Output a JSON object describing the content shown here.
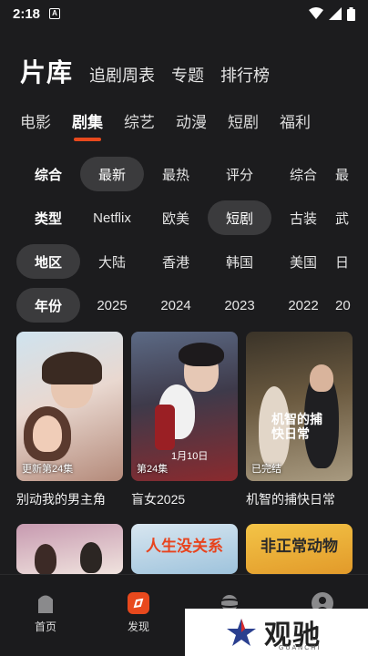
{
  "status_bar": {
    "time": "2:18",
    "notif_letter": "A"
  },
  "header": {
    "title": "片库",
    "nav": [
      "追剧周表",
      "专题",
      "排行榜"
    ]
  },
  "subtabs": [
    "电影",
    "剧集",
    "综艺",
    "动漫",
    "短剧",
    "福利"
  ],
  "filters": {
    "sort": [
      "综合",
      "最新",
      "最热",
      "评分",
      "综合",
      "最"
    ],
    "type": [
      "类型",
      "Netflix",
      "欧美",
      "短剧",
      "古装",
      "武"
    ],
    "region": [
      "地区",
      "大陆",
      "香港",
      "韩国",
      "美国",
      "日"
    ],
    "year": [
      "年份",
      "2025",
      "2024",
      "2023",
      "2022",
      "20"
    ]
  },
  "cards": [
    {
      "name": "别动我的男主角",
      "badge": "更新第24集"
    },
    {
      "name": "盲女2025",
      "badge": "第24集",
      "date_text": "1月10日"
    },
    {
      "name": "机智的捕快日常",
      "badge": "已完结",
      "poster_text": "机智的捕快日常"
    }
  ],
  "cards_row2": [
    {
      "poster_text": ""
    },
    {
      "poster_text": "人生没关系"
    },
    {
      "poster_text": "非正常动物"
    }
  ],
  "tabbar": {
    "home": "首页",
    "discover": "发现"
  },
  "watermark": {
    "brand": "观驰",
    "sub": "GUANCHI"
  },
  "colors": {
    "accent": "#e8491d",
    "background": "#1c1c1e",
    "chip_selected": "#3b3b3d"
  }
}
